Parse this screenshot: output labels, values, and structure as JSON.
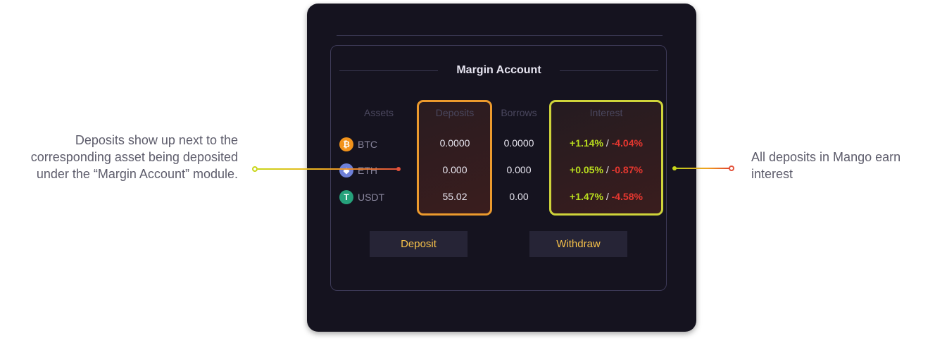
{
  "annotations": {
    "left": "Deposits show up next to the corresponding asset being deposited under the “Margin Account” module.",
    "right": "All deposits in Mango earn interest"
  },
  "panel": {
    "title": "Margin Account",
    "columns": {
      "assets": "Assets",
      "deposits": "Deposits",
      "borrows": "Borrows",
      "interest": "Interest"
    },
    "rows": [
      {
        "asset": "BTC",
        "icon": "bitcoin-icon",
        "deposits": "0.0000",
        "borrows": "0.0000",
        "interest_pos": "+1.14%",
        "interest_sep": "/",
        "interest_neg": "-4.04%"
      },
      {
        "asset": "ETH",
        "icon": "ethereum-icon",
        "deposits": "0.000",
        "borrows": "0.000",
        "interest_pos": "+0.05%",
        "interest_sep": "/",
        "interest_neg": "-0.87%"
      },
      {
        "asset": "USDT",
        "icon": "tether-icon",
        "deposits": "55.02",
        "borrows": "0.00",
        "interest_pos": "+1.47%",
        "interest_sep": "/",
        "interest_neg": "-4.58%"
      }
    ],
    "buttons": {
      "deposit": "Deposit",
      "withdraw": "Withdraw"
    }
  },
  "colors": {
    "card_bg": "#15131f",
    "accent_yellow": "#f6c14a",
    "positive": "#b8dc1e",
    "negative": "#e6372f",
    "highlight_orange": "#ec9a2d",
    "highlight_yellow": "#cfd43a"
  }
}
